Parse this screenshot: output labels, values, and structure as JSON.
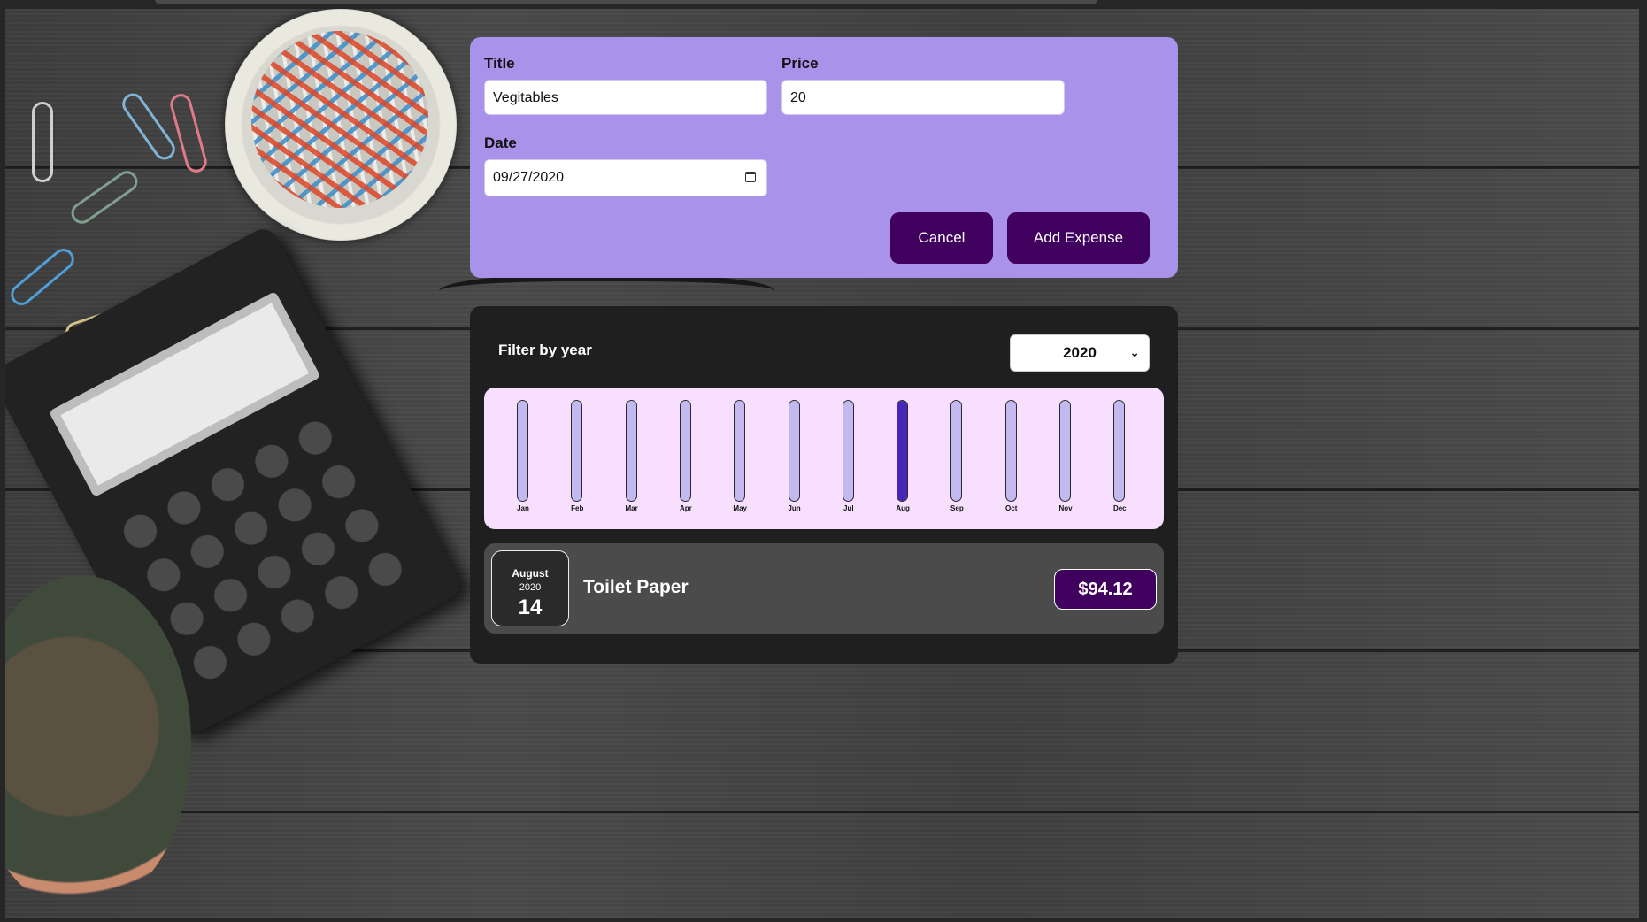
{
  "form": {
    "title_label": "Title",
    "title_value": "Vegitables",
    "price_label": "Price",
    "price_value": "20",
    "date_label": "Date",
    "date_value": "09/27/2020",
    "cancel_label": "Cancel",
    "add_label": "Add Expense"
  },
  "filter": {
    "label": "Filter by year",
    "selected_year": "2020"
  },
  "chart_data": {
    "type": "bar",
    "categories": [
      "Jan",
      "Feb",
      "Mar",
      "Apr",
      "May",
      "Jun",
      "Jul",
      "Aug",
      "Sep",
      "Oct",
      "Nov",
      "Dec"
    ],
    "values": [
      0,
      0,
      0,
      0,
      0,
      0,
      0,
      94.12,
      0,
      0,
      0,
      0
    ],
    "fill_fraction": [
      0,
      0,
      0,
      0,
      0,
      0,
      0,
      1,
      0,
      0,
      0,
      0
    ],
    "title": "",
    "xlabel": "",
    "ylabel": ""
  },
  "expenses": [
    {
      "month": "August",
      "year": "2020",
      "day": "14",
      "title": "Toilet Paper",
      "price": "$94.12"
    }
  ],
  "colors": {
    "form_bg": "#a892ea",
    "button_bg": "#40005e",
    "chart_bg": "#f8dfff",
    "bar_track": "#c3b9f1",
    "bar_fill": "#4826b9",
    "card_bg": "#1f1f1f",
    "item_bg": "#4b4b4b"
  },
  "icons": {
    "date_picker": "calendar-icon",
    "select": "chevron-down-icon"
  }
}
